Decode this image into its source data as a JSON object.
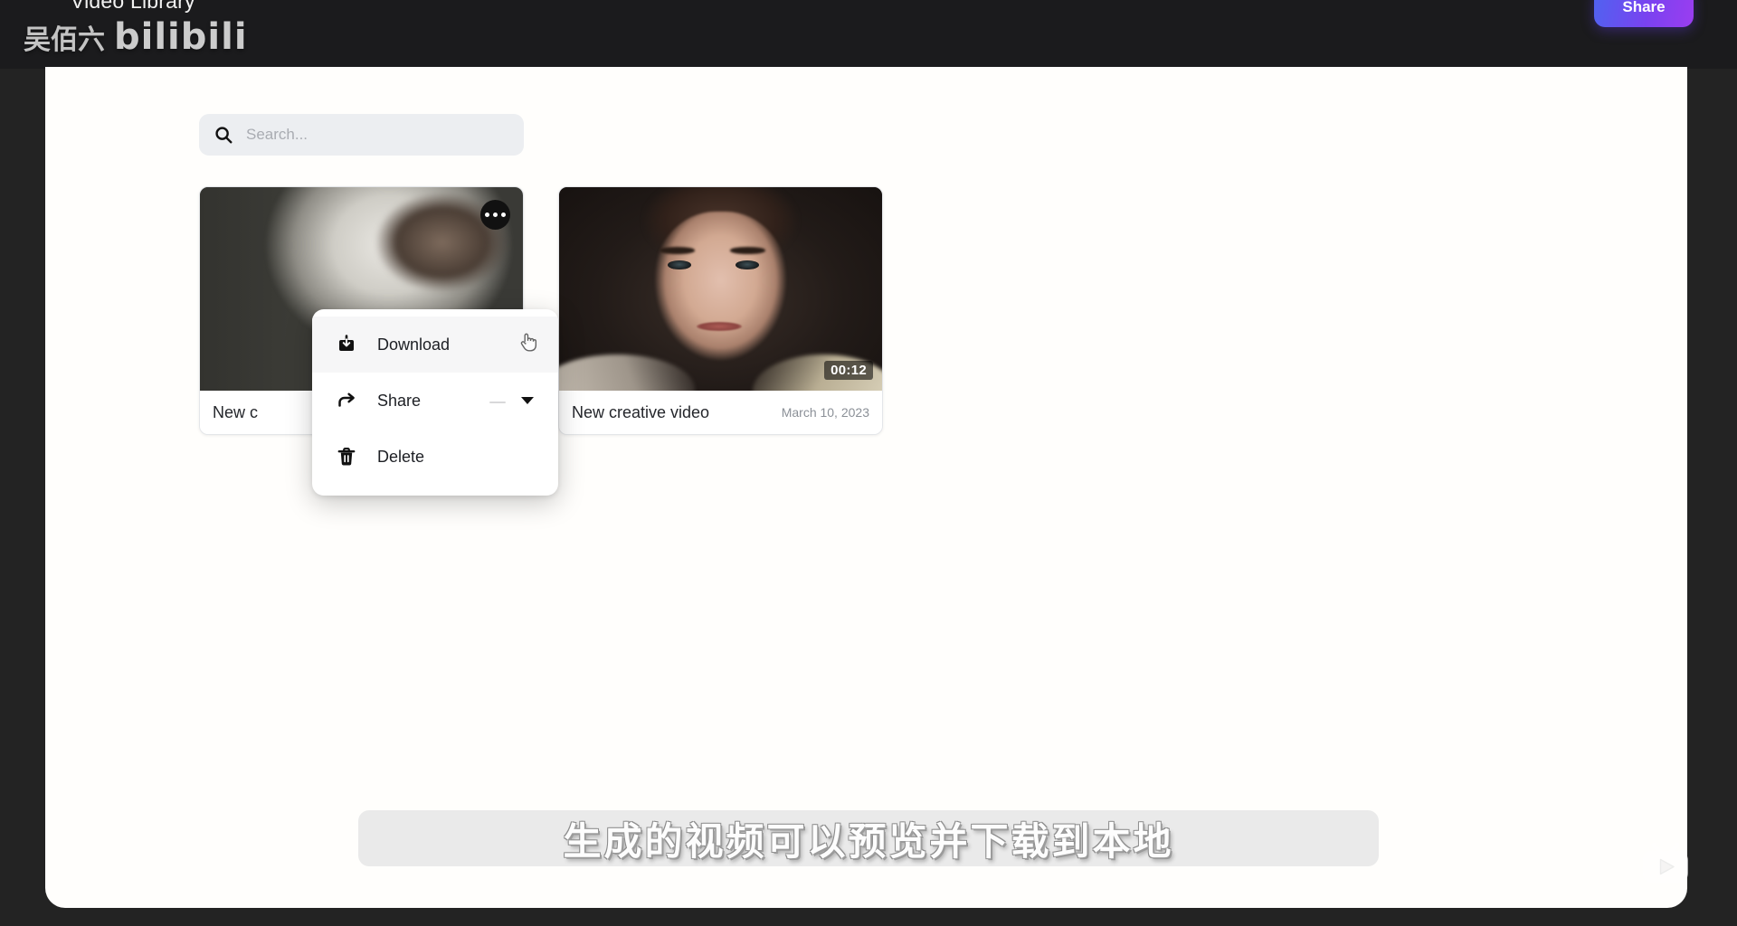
{
  "window": {
    "background_color": "#232323",
    "header_bg": "#1b1b1d",
    "panel_bg": "#fffefc"
  },
  "header": {
    "title": "Video Library",
    "share_label": "Share",
    "share_gradient_from": "#4f63f0",
    "share_gradient_to": "#9b3df0"
  },
  "search": {
    "placeholder": "Search...",
    "value": "",
    "icon": "search-icon"
  },
  "cards": [
    {
      "title": "New c",
      "date": "",
      "duration": "",
      "menu_icon": "more-horizontal-icon",
      "thumbnail_alt": "dark video thumbnail with pale hair"
    },
    {
      "title": "New creative video",
      "date": "March 10, 2023",
      "duration": "00:12",
      "menu_icon": "more-horizontal-icon",
      "thumbnail_alt": "portrait of a young person"
    }
  ],
  "context_menu": {
    "items": [
      {
        "label": "Download",
        "icon": "download-icon",
        "highlighted": true,
        "has_caret": false
      },
      {
        "label": "Share",
        "icon": "share-arrow-icon",
        "highlighted": false,
        "has_caret": true
      },
      {
        "label": "Delete",
        "icon": "trash-icon",
        "highlighted": false,
        "has_caret": false
      }
    ]
  },
  "subtitle": {
    "text": "生成的视频可以预览并下载到本地",
    "bar_color": "#e8e8e8"
  },
  "watermarks": {
    "top_left_name": "吴佰六",
    "top_left_logo": "bilibili",
    "bottom_right_icon": "bilibili-tv-logo-icon"
  }
}
